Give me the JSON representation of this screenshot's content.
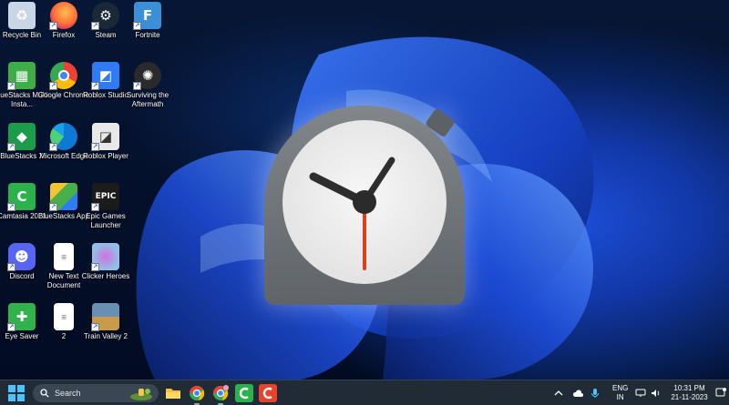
{
  "desktop": {
    "icons": [
      {
        "label": "Recycle Bin",
        "icon": "recycle-bin-icon",
        "color": "#c8d6e5"
      },
      {
        "label": "Firefox",
        "icon": "firefox-icon",
        "color": "#ff7139"
      },
      {
        "label": "Steam",
        "icon": "steam-icon",
        "color": "#1b2838"
      },
      {
        "label": "Fortnite",
        "icon": "fortnite-icon",
        "color": "#3a8fd6"
      },
      {
        "label": "BlueStacks Multi-Insta...",
        "icon": "bluestacks-multi-instance-icon",
        "color": "#3fae49"
      },
      {
        "label": "Google Chrome",
        "icon": "chrome-icon",
        "color": "#ea4335"
      },
      {
        "label": "Roblox Studio",
        "icon": "roblox-studio-icon",
        "color": "#2f7bf5"
      },
      {
        "label": "Surviving the Aftermath",
        "icon": "surviving-the-aftermath-icon",
        "color": "#2a2a2a"
      },
      {
        "label": "BlueStacks X",
        "icon": "bluestacks-x-icon",
        "color": "#1a9c4a"
      },
      {
        "label": "Microsoft Edge",
        "icon": "edge-icon",
        "color": "#0f78d4"
      },
      {
        "label": "Roblox Player",
        "icon": "roblox-player-icon",
        "color": "#e8e8e8"
      },
      {
        "label": "Camtasia 2021",
        "icon": "camtasia-icon",
        "color": "#2bb24c"
      },
      {
        "label": "BlueStacks App",
        "icon": "bluestacks-app-icon",
        "color": "#47b04b"
      },
      {
        "label": "Epic Games Launcher",
        "icon": "epic-games-icon",
        "color": "#1b1b1b"
      },
      {
        "label": "Discord",
        "icon": "discord-icon",
        "color": "#5865f2"
      },
      {
        "label": "New Text Document",
        "icon": "text-document-icon",
        "color": "#ffffff"
      },
      {
        "label": "Clicker Heroes",
        "icon": "clicker-heroes-icon",
        "color": "#8fc1e8"
      },
      {
        "label": "Eye Saver",
        "icon": "eye-saver-icon",
        "color": "#32b24a"
      },
      {
        "label": "2",
        "icon": "text-document-icon",
        "color": "#ffffff"
      },
      {
        "label": "Train Valley 2",
        "icon": "train-valley-icon",
        "color": "#6a8fb5"
      }
    ],
    "overlay_icon": "alarms-clock-app-icon"
  },
  "taskbar": {
    "start": "windows-start-icon",
    "search_placeholder": "Search",
    "apps": [
      {
        "icon": "file-explorer-icon",
        "color": "#f5c13b"
      },
      {
        "icon": "chrome-icon",
        "color": "#ea4335"
      },
      {
        "icon": "chrome-icon",
        "color": "#34a853"
      },
      {
        "icon": "camtasia-icon",
        "color": "#2bb24c"
      },
      {
        "icon": "camtasia-recorder-icon",
        "color": "#e8432e"
      }
    ],
    "tray": {
      "lang_top": "ENG",
      "lang_bottom": "IN",
      "time": "10:31 PM",
      "date": "21-11-2023"
    }
  },
  "colors": {
    "clock_body": "#6f7479",
    "clock_face": "#ececec",
    "second_hand": "#d8411e",
    "taskbar": "#202b36"
  }
}
